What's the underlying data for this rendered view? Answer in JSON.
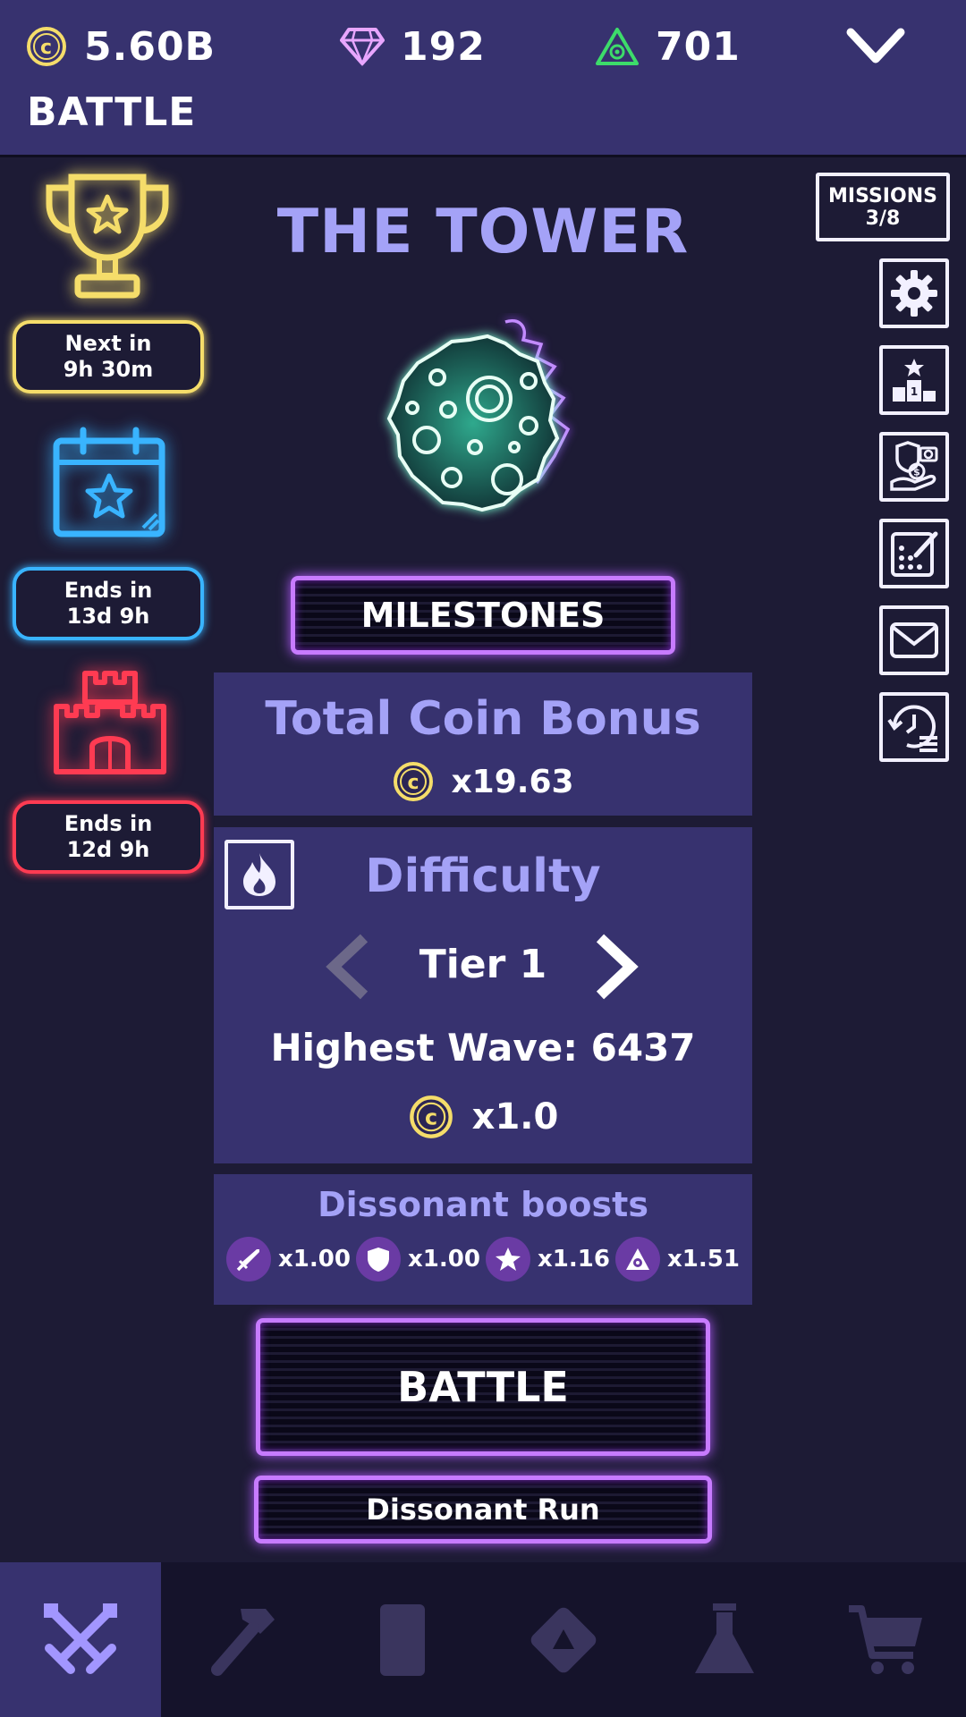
{
  "header": {
    "coins": "5.60B",
    "gems": "192",
    "stones": "701",
    "title": "BATTLE"
  },
  "events": [
    {
      "name": "tournament",
      "label_line1": "Next in",
      "label_line2": "9h 30m",
      "color": "#f5dd6a"
    },
    {
      "name": "event",
      "label_line1": "Ends in",
      "label_line2": "13d 9h",
      "color": "#39b4ff"
    },
    {
      "name": "guild",
      "label_line1": "Ends in",
      "label_line2": "12d 9h",
      "color": "#ff3b52"
    }
  ],
  "missions": {
    "label": "MISSIONS",
    "progress": "3/8"
  },
  "side_icons": [
    "settings-icon",
    "leaderboard-icon",
    "offers-icon",
    "stats-icon",
    "mail-icon",
    "history-icon"
  ],
  "main": {
    "title": "THE TOWER",
    "milestones_label": "MILESTONES",
    "coin_bonus_title": "Total Coin Bonus",
    "coin_bonus_value": "x19.63",
    "difficulty_title": "Difficulty",
    "tier": "Tier 1",
    "highest_wave": "Highest Wave: 6437",
    "tier_multiplier": "x1.0",
    "boosts_title": "Dissonant boosts",
    "boosts": [
      {
        "icon": "sword-icon",
        "value": "x1.00"
      },
      {
        "icon": "shield-icon",
        "value": "x1.00"
      },
      {
        "icon": "star-icon",
        "value": "x1.16"
      },
      {
        "icon": "stone-icon",
        "value": "x1.51"
      }
    ],
    "battle_label": "BATTLE",
    "dissonant_run_label": "Dissonant Run"
  },
  "bottom_nav": [
    "battle-icon",
    "workshop-icon",
    "cards-icon",
    "modules-icon",
    "labs-icon",
    "shop-icon"
  ],
  "colors": {
    "header_bg": "#37326f",
    "page_bg": "#1d1b35",
    "title_accent": "#a4a2f7",
    "neon_purple": "#c77bff",
    "gold": "#f5dd6a",
    "stone_green": "#3ddc6a",
    "gem_pink": "#e8a6ff"
  }
}
